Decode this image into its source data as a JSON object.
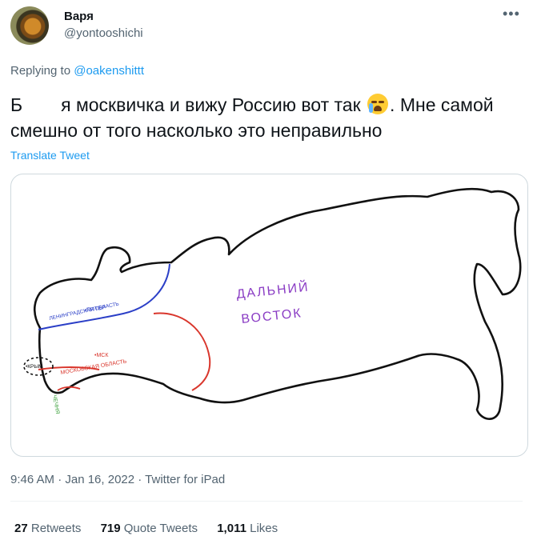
{
  "author": {
    "name": "Варя",
    "handle": "@yontooshichi"
  },
  "more_icon": "•••",
  "reply": {
    "prefix": "Replying to ",
    "to": "@oakenshittt"
  },
  "tweet": {
    "text_first": "Б",
    "text_part1": "я москвичка и вижу Россию вот так",
    "emoji": "loudly-crying-face",
    "text_part2": ". Мне самой смешно от того насколько это неправильно",
    "translate": "Translate Tweet"
  },
  "map": {
    "east": "ДАЛЬНИЙ",
    "east2": "ВОСТОК",
    "leningrad": "ЛЕНИНГРАДСКАЯ ОБЛАСТЬ",
    "piter": "•ПИТЕР",
    "msk": "•МСК",
    "moscow_region": "МОСКОВСКАЯ ОБЛАСТЬ",
    "crimea": "•КРЫМ",
    "chechnya": "ЧЕЧНЯ",
    "colors": {
      "outline": "#111111",
      "leningrad": "#2b3fc7",
      "moscow": "#d9362c",
      "far_east": "#8a3cc4",
      "chechnya": "#3aa03a"
    }
  },
  "meta": {
    "time": "9:46 AM · Jan 16, 2022 · Twitter for iPad"
  },
  "stats": {
    "retweets_count": "27",
    "retweets_label": " Retweets",
    "quotes_count": "719",
    "quotes_label": " Quote Tweets",
    "likes_count": "1,011",
    "likes_label": " Likes"
  }
}
